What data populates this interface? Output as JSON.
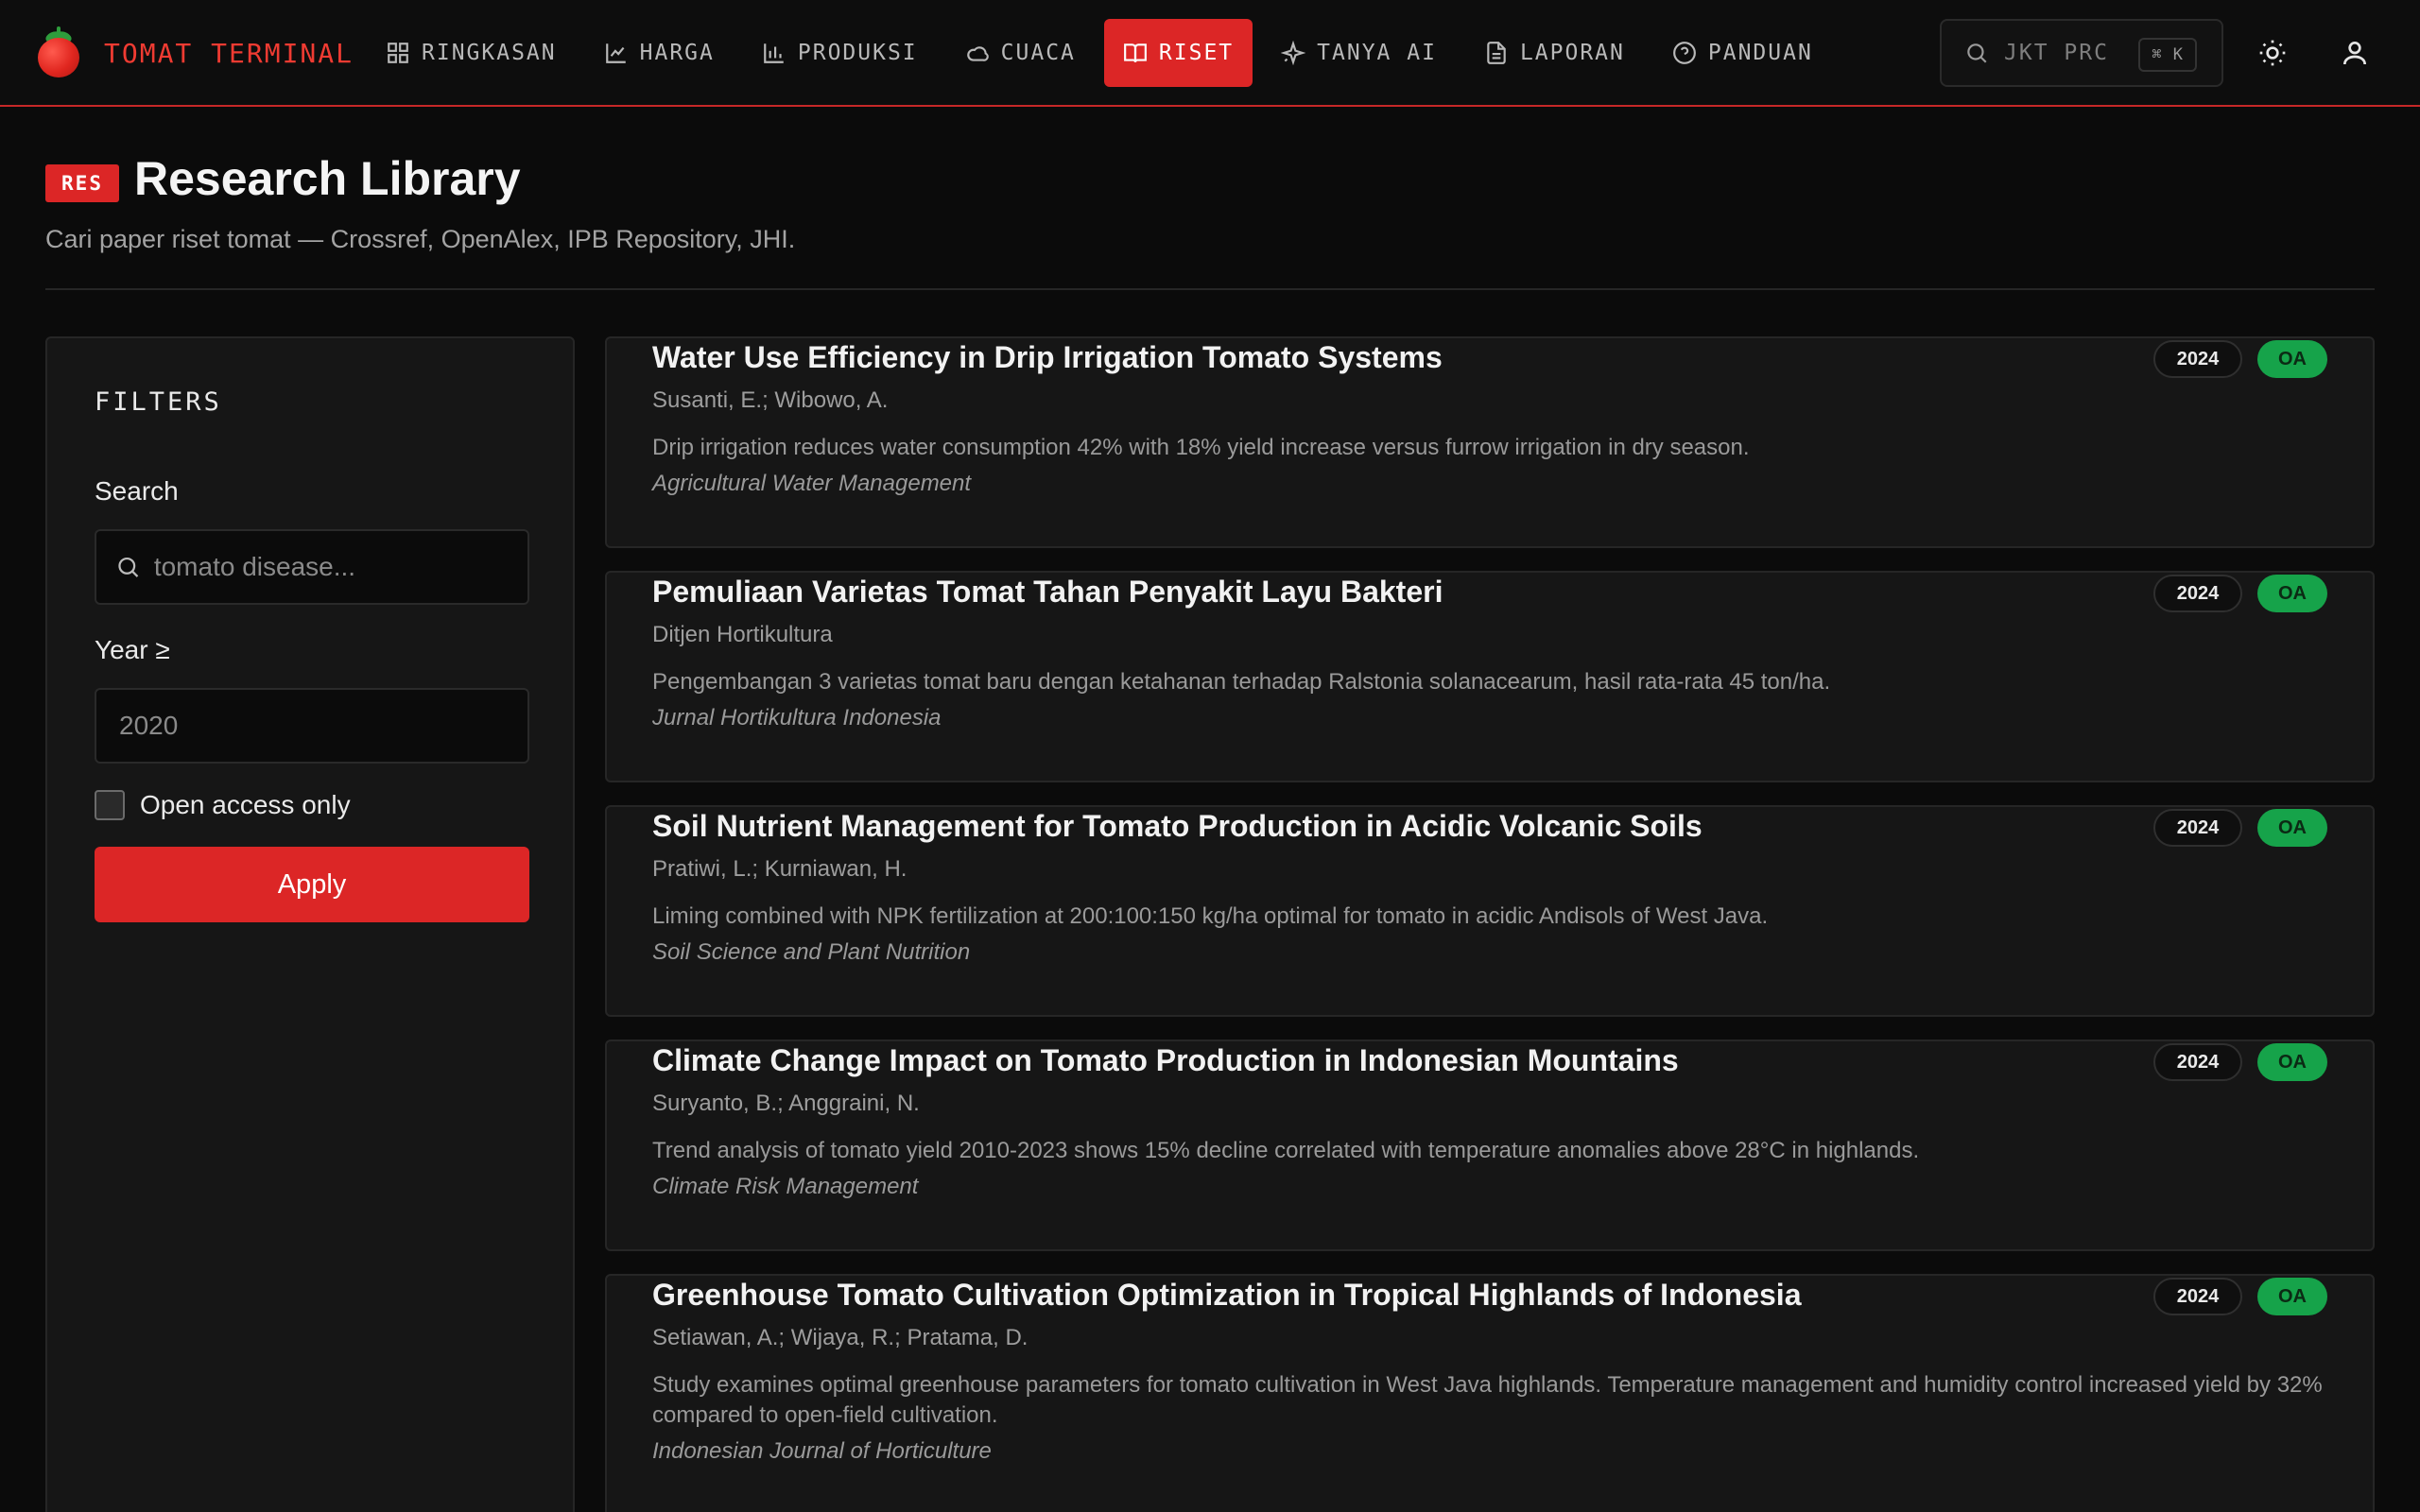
{
  "brand": {
    "name": "TOMAT TERMINAL"
  },
  "nav": {
    "items": [
      {
        "label": "RINGKASAN",
        "icon": "dashboard-icon"
      },
      {
        "label": "HARGA",
        "icon": "line-chart-icon"
      },
      {
        "label": "PRODUKSI",
        "icon": "bar-chart-icon"
      },
      {
        "label": "CUACA",
        "icon": "cloud-icon"
      },
      {
        "label": "RISET",
        "icon": "book-icon",
        "active": true
      },
      {
        "label": "TANYA AI",
        "icon": "sparkle-icon"
      },
      {
        "label": "LAPORAN",
        "icon": "document-icon"
      },
      {
        "label": "PANDUAN",
        "icon": "help-circle-icon"
      }
    ],
    "search": {
      "text": "JKT PRC",
      "shortcut": "⌘ K"
    }
  },
  "page": {
    "badge": "RES",
    "title": "Research Library",
    "subtitle": "Cari paper riset tomat — Crossref, OpenAlex, IPB Repository, JHI."
  },
  "filters": {
    "title": "FILTERS",
    "search_label": "Search",
    "search_placeholder": "tomato disease...",
    "year_label": "Year ≥",
    "year_placeholder": "2020",
    "open_access_label": "Open access only",
    "open_access_checked": false,
    "apply_label": "Apply"
  },
  "results": [
    {
      "title": "Water Use Efficiency in Drip Irrigation Tomato Systems",
      "authors": "Susanti, E.; Wibowo, A.",
      "abstract": "Drip irrigation reduces water consumption 42% with 18% yield increase versus furrow irrigation in dry season.",
      "journal": "Agricultural Water Management",
      "year": "2024",
      "badge": "OA"
    },
    {
      "title": "Pemuliaan Varietas Tomat Tahan Penyakit Layu Bakteri",
      "authors": "Ditjen Hortikultura",
      "abstract": "Pengembangan 3 varietas tomat baru dengan ketahanan terhadap Ralstonia solanacearum, hasil rata-rata 45 ton/ha.",
      "journal": "Jurnal Hortikultura Indonesia",
      "year": "2024",
      "badge": "OA"
    },
    {
      "title": "Soil Nutrient Management for Tomato Production in Acidic Volcanic Soils",
      "authors": "Pratiwi, L.; Kurniawan, H.",
      "abstract": "Liming combined with NPK fertilization at 200:100:150 kg/ha optimal for tomato in acidic Andisols of West Java.",
      "journal": "Soil Science and Plant Nutrition",
      "year": "2024",
      "badge": "OA"
    },
    {
      "title": "Climate Change Impact on Tomato Production in Indonesian Mountains",
      "authors": "Suryanto, B.; Anggraini, N.",
      "abstract": "Trend analysis of tomato yield 2010-2023 shows 15% decline correlated with temperature anomalies above 28°C in highlands.",
      "journal": "Climate Risk Management",
      "year": "2024",
      "badge": "OA"
    },
    {
      "title": "Greenhouse Tomato Cultivation Optimization in Tropical Highlands of Indonesia",
      "authors": "Setiawan, A.; Wijaya, R.; Pratama, D.",
      "abstract": "Study examines optimal greenhouse parameters for tomato cultivation in West Java highlands. Temperature management and humidity control increased yield by 32% compared to open-field cultivation.",
      "journal": "Indonesian Journal of Horticulture",
      "year": "2024",
      "badge": "OA"
    }
  ],
  "colors": {
    "accent": "#dc2626",
    "brand_text": "#ef3b32",
    "open_access": "#16a34a",
    "background": "#0b0b0b",
    "card": "#161616"
  }
}
